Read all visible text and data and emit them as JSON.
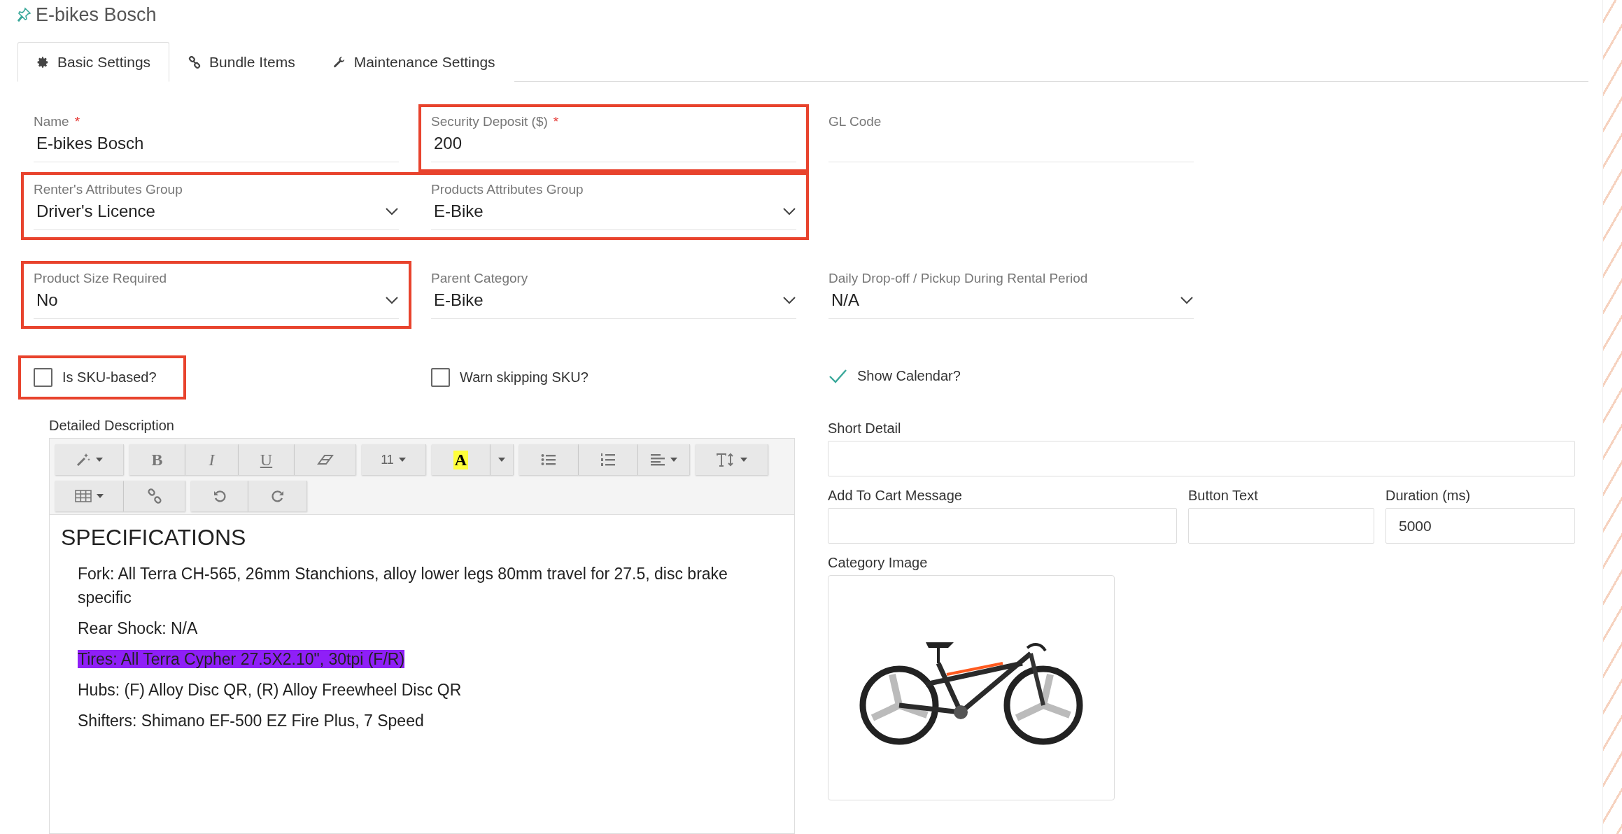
{
  "title": "E-bikes Bosch",
  "tabs": [
    {
      "kind": "gear",
      "label": "Basic Settings",
      "selected": true
    },
    {
      "kind": "link",
      "label": "Bundle Items",
      "selected": false
    },
    {
      "kind": "wrench",
      "label": "Maintenance Settings",
      "selected": false
    }
  ],
  "rows": [
    {
      "fields": [
        {
          "kind": "text",
          "label": "Name",
          "required_mark": "*",
          "value": "E-bikes Bosch",
          "highlighted": false
        },
        {
          "kind": "text",
          "label": "Security Deposit ($)",
          "required_mark": "*",
          "value": "200",
          "highlighted": true
        },
        {
          "kind": "text",
          "label": "GL Code",
          "highlighted": false
        }
      ]
    },
    {
      "fields": [
        {
          "kind": "select",
          "label": "Renter's Attributes Group",
          "value": "Driver's Licence",
          "highlighted": true
        },
        {
          "kind": "select",
          "label": "Products Attributes Group",
          "value": "E-Bike",
          "highlighted": true
        }
      ]
    },
    {
      "fields": [
        {
          "kind": "select",
          "label": "Product Size Required",
          "value": "No",
          "highlighted": true
        },
        {
          "kind": "select",
          "label": "Parent Category",
          "value": "E-Bike",
          "highlighted": false
        },
        {
          "kind": "select",
          "label": "Daily Drop-off / Pickup During Rental Period",
          "value": "N/A",
          "highlighted": false
        }
      ]
    }
  ],
  "checkboxes": [
    {
      "label": "Is SKU-based?",
      "checked": false,
      "highlighted": true
    },
    {
      "label": "Warn skipping SKU?",
      "checked": false,
      "highlighted": false
    },
    {
      "label": "Show Calendar?",
      "checked": true,
      "highlighted": false
    }
  ],
  "description": {
    "label": "Detailed Description",
    "toolbar": [
      [
        {
          "buttons": [
            {
              "kind": "wand",
              "caret": true
            }
          ]
        },
        {
          "buttons": [
            {
              "kind": "bold",
              "label": "B"
            },
            {
              "kind": "italic",
              "label": "I"
            },
            {
              "kind": "underline",
              "label": "U"
            },
            {
              "kind": "eraser"
            }
          ]
        },
        {
          "buttons": [
            {
              "kind": "size",
              "label": "11",
              "caret": true
            }
          ]
        },
        {
          "buttons": [
            {
              "kind": "color",
              "label": "A"
            },
            {
              "kind": "dropdown",
              "caret": true
            }
          ]
        },
        {
          "buttons": [
            {
              "kind": "bullets"
            },
            {
              "kind": "numbers"
            },
            {
              "kind": "align",
              "caret": true
            }
          ]
        },
        {
          "buttons": [
            {
              "kind": "height",
              "caret": true
            }
          ]
        }
      ],
      [
        {
          "buttons": [
            {
              "kind": "table",
              "caret": true
            },
            {
              "kind": "link"
            }
          ]
        },
        {
          "buttons": [
            {
              "kind": "undo"
            },
            {
              "kind": "redo"
            }
          ]
        }
      ]
    ],
    "heading": "SPECIFICATIONS",
    "paragraphs": [
      {
        "text": "Fork: All Terra CH-565, 26mm Stanchions, alloy lower legs 80mm travel for 27.5, disc brake specific",
        "highlighted": false
      },
      {
        "text": "Rear Shock: N/A",
        "highlighted": false
      },
      {
        "text": "Tires: All Terra Cypher 27.5X2.10\", 30tpi (F/R)",
        "highlighted": true
      },
      {
        "text": "Hubs: (F) Alloy Disc QR, (R) Alloy Freewheel Disc QR",
        "highlighted": false
      },
      {
        "text": "Shifters: Shimano EF-500 EZ Fire Plus, 7 Speed",
        "highlighted": false
      }
    ]
  },
  "side": {
    "short_detail": {
      "label": "Short Detail"
    },
    "add_to_cart": {
      "label": "Add To Cart Message"
    },
    "button_text": {
      "label": "Button Text"
    },
    "duration": {
      "label": "Duration (ms)",
      "value": "5000"
    },
    "category_image": {
      "label": "Category Image"
    }
  }
}
